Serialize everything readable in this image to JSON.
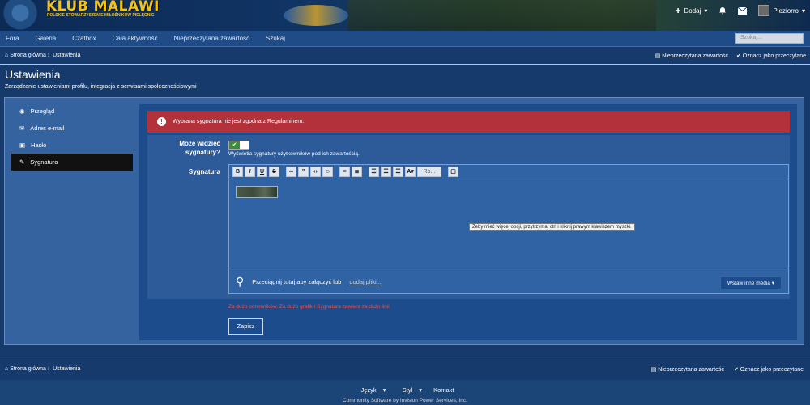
{
  "header": {
    "logo_title": "KLUB MALAWI",
    "logo_subtitle": "POLSKIE STOWARZYSZENIE MIŁOŚNIKÓW PIELĘGNIC",
    "add_label": "Dodaj",
    "username": "Pleziorro"
  },
  "nav": {
    "items": [
      "Fora",
      "Galeria",
      "Czatbox",
      "Cała aktywność",
      "Nieprzeczytana zawartość",
      "Szukaj"
    ],
    "search_placeholder": "Szukaj..."
  },
  "breadcrumb": {
    "home": "Strona główna",
    "current": "Ustawienia",
    "unread": "Nieprzeczytana zawartość",
    "mark_read": "Oznacz jako przeczytane"
  },
  "page": {
    "title": "Ustawienia",
    "description": "Zarządzanie ustawieniami profilu, integracja z serwisami społecznościowymi"
  },
  "sidebar": {
    "items": [
      {
        "label": "Przegląd"
      },
      {
        "label": "Adres e-mail"
      },
      {
        "label": "Hasło"
      },
      {
        "label": "Sygnatura"
      }
    ]
  },
  "form": {
    "alert": "Wybrana sygnatura nie jest zgodna z Regulaminem.",
    "can_see_label_1": "Może widzieć",
    "can_see_label_2": "sygnatury?",
    "can_see_desc": "Wyświetla sygnatury użytkowników pod ich zawartością.",
    "signature_label": "Sygnatura",
    "font_select": "Ro...",
    "tooltip": "Żeby mieć więcej opcji, przytrzymaj ctrl i kliknij prawym klawiszem myszki.",
    "attach_text": "Przeciągnij tutaj aby załączyć lub",
    "attach_link": "dodaj pliki...",
    "insert_media": "Wstaw inne media",
    "error_text": "Za dużo odnośników. Za dużo grafik i Sygnatura zawiera za dużo linii",
    "submit": "Zapisz"
  },
  "footer": {
    "language": "Język",
    "style": "Styl",
    "contact": "Kontakt",
    "copyright": "Community Software by Invision Power Services, Inc."
  }
}
